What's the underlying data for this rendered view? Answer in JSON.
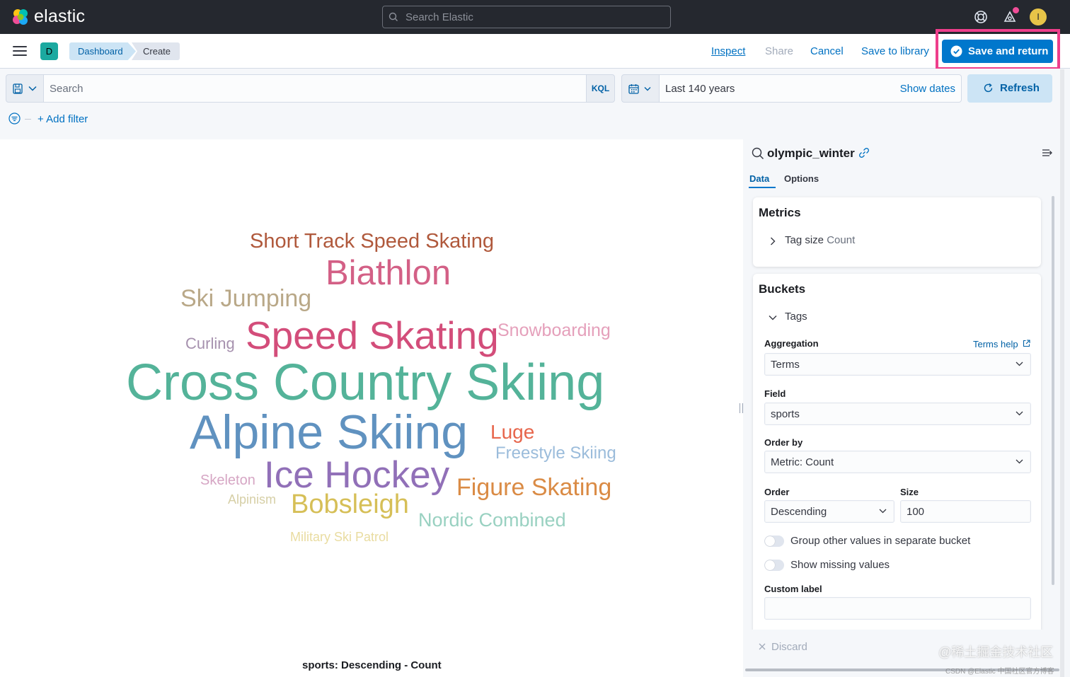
{
  "header": {
    "brand": "elastic",
    "search_placeholder": "Search Elastic",
    "user_initial": "I"
  },
  "subbar": {
    "space_initial": "D",
    "breadcrumbs": [
      "Dashboard",
      "Create"
    ],
    "links": {
      "inspect": "Inspect",
      "share": "Share",
      "cancel": "Cancel",
      "save_to_library": "Save to library"
    },
    "save_and_return": "Save and return"
  },
  "query_bar": {
    "search_placeholder": "Search",
    "language": "KQL",
    "date_range": "Last 140 years",
    "show_dates": "Show dates",
    "refresh": "Refresh",
    "add_filter": "+ Add filter"
  },
  "visualization": {
    "type": "tag-cloud",
    "words": [
      {
        "text": "Short Track Speed Skating",
        "color": "#b0593c"
      },
      {
        "text": "Biathlon",
        "color": "#d36086"
      },
      {
        "text": "Ski Jumping",
        "color": "#b9a888"
      },
      {
        "text": "Curling",
        "color": "#a691ae"
      },
      {
        "text": "Speed Skating",
        "color": "#d34d7a"
      },
      {
        "text": "Snowboarding",
        "color": "#e5a0bb"
      },
      {
        "text": "Cross Country Skiing",
        "color": "#54b399"
      },
      {
        "text": "Alpine Skiing",
        "color": "#6092c0"
      },
      {
        "text": "Luge",
        "color": "#e7664c"
      },
      {
        "text": "Freestyle Skiing",
        "color": "#9bbcdb"
      },
      {
        "text": "Skeleton",
        "color": "#d6a6c4"
      },
      {
        "text": "Ice Hockey",
        "color": "#9170b8"
      },
      {
        "text": "Figure Skating",
        "color": "#da8b45"
      },
      {
        "text": "Alpinism",
        "color": "#d6cfa6"
      },
      {
        "text": "Bobsleigh",
        "color": "#d6bf57"
      },
      {
        "text": "Nordic Combined",
        "color": "#99d1c1"
      },
      {
        "text": "Military Ski Patrol",
        "color": "#e9dca0"
      }
    ],
    "caption": "sports: Descending - Count"
  },
  "editor": {
    "index_pattern": "olympic_winter",
    "tabs": [
      "Data",
      "Options"
    ],
    "metrics": {
      "title": "Metrics",
      "item_label": "Tag size",
      "item_value": "Count"
    },
    "buckets": {
      "title": "Buckets",
      "item_label": "Tags",
      "aggregation_label": "Aggregation",
      "terms_help": "Terms help",
      "aggregation_value": "Terms",
      "field_label": "Field",
      "field_value": "sports",
      "order_by_label": "Order by",
      "order_by_value": "Metric: Count",
      "order_label": "Order",
      "order_value": "Descending",
      "size_label": "Size",
      "size_value": "100",
      "group_other_label": "Group other values in separate bucket",
      "show_missing_label": "Show missing values",
      "custom_label_label": "Custom label",
      "custom_label_value": ""
    },
    "discard": "Discard"
  },
  "watermark": {
    "main": "@稀土掘金技术社区",
    "sub": "CSDN @Elastic 中国社区官方博客"
  }
}
